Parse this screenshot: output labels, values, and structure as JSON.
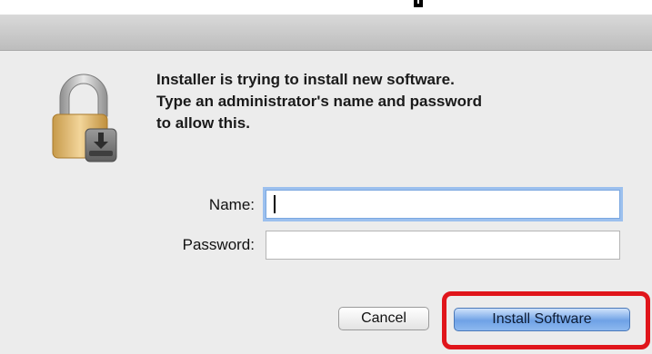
{
  "dialog": {
    "message_lines": [
      "Installer is trying to install new software.",
      "Type an administrator's name and password",
      "to allow this."
    ]
  },
  "form": {
    "name_label": "Name:",
    "name_value": "",
    "password_label": "Password:",
    "password_value": ""
  },
  "buttons": {
    "cancel_label": "Cancel",
    "install_label": "Install Software"
  },
  "icons": {
    "lock": "lock-icon",
    "download": "download-arrow-icon"
  },
  "colors": {
    "highlight": "#e0151b",
    "default_button": "#6fa2e6",
    "focus_ring": "#9cc0ee"
  }
}
